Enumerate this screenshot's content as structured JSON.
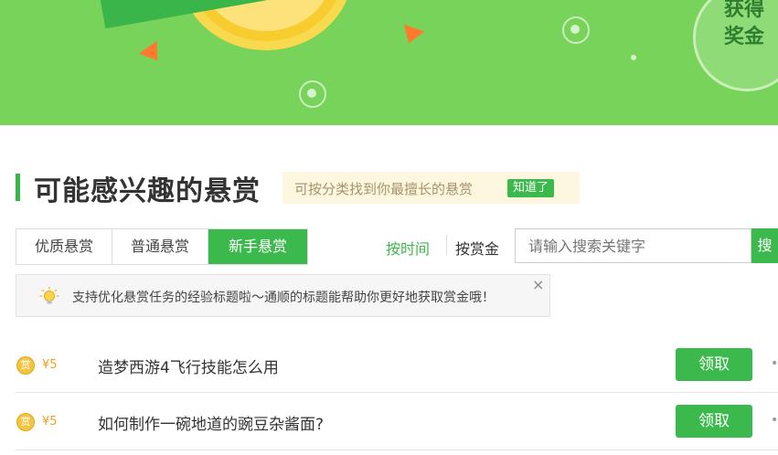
{
  "banner": {
    "reward_line1": "获得",
    "reward_line2": "奖金"
  },
  "section": {
    "title": "可能感兴趣的悬赏",
    "hint": "可按分类找到你最擅长的悬赏",
    "hint_button": "知道了"
  },
  "tabs": [
    {
      "label": "优质悬赏",
      "active": false
    },
    {
      "label": "普通悬赏",
      "active": false
    },
    {
      "label": "新手悬赏",
      "active": true
    }
  ],
  "sort": {
    "by_time": "按时间",
    "by_reward": "按赏金"
  },
  "search": {
    "placeholder": "请输入搜索关键字",
    "button": "搜"
  },
  "notice": {
    "icon": "lightbulb-icon",
    "text": "支持优化悬赏任务的经验标题啦～通顺的标题能帮助你更好地获取赏金哦！",
    "close": "×"
  },
  "bounties": [
    {
      "coin": "赏",
      "amount": "¥5",
      "title": "造梦西游4飞行技能怎么用",
      "button": "领取",
      "more": "•"
    },
    {
      "coin": "赏",
      "amount": "¥5",
      "title": "如何制作一碗地道的豌豆杂酱面?",
      "button": "领取",
      "more": "•"
    }
  ],
  "colors": {
    "brand_green": "#3cb94c",
    "banner_green": "#78d35b",
    "amount_orange": "#f0a020"
  }
}
